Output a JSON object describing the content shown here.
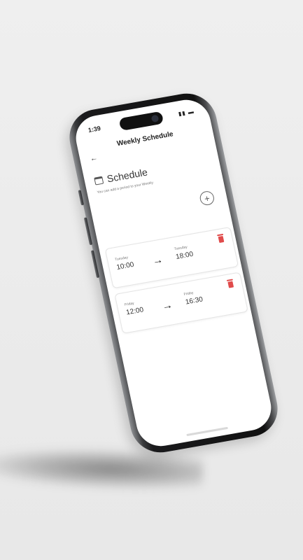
{
  "status_bar": {
    "time": "1:39",
    "icons": "▮▮ ▬"
  },
  "header": {
    "title": "Weekly Schedule",
    "back_icon": "arrow-left-icon"
  },
  "section": {
    "icon": "calendar-icon",
    "title": "Schedule",
    "description": "You can add a period to your Weekly",
    "add_icon": "plus-circle-icon"
  },
  "entries": [
    {
      "from_day": "Tuesday",
      "from_time": "10:00",
      "to_day": "Tuesday",
      "to_time": "18:00"
    },
    {
      "from_day": "Friday",
      "from_time": "12:00",
      "to_day": "Friday",
      "to_time": "16:30"
    }
  ],
  "colors": {
    "delete": "#e04b4b",
    "background": "#ececec",
    "screen": "#ffffff"
  }
}
